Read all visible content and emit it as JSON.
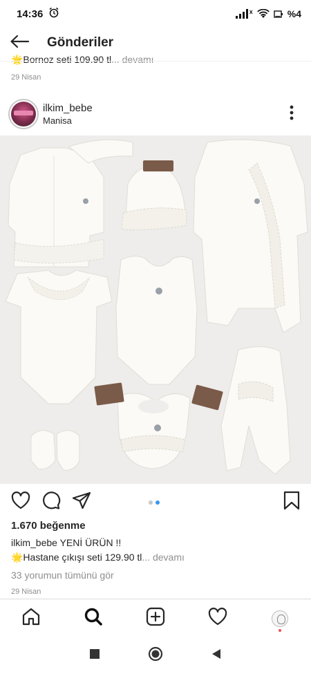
{
  "status_bar": {
    "time": "14:36",
    "battery": "%4"
  },
  "header": {
    "title": "Gönderiler"
  },
  "previous_post": {
    "caption_text": "🌟Bornoz seti 109.90 tl",
    "more_text": "... devamı",
    "date": "29 Nisan"
  },
  "post": {
    "username": "ilkim_bebe",
    "location": "Manisa",
    "likes": "1.670 beğenme",
    "caption_user": "ilkim_bebe",
    "caption_text": "YENİ ÜRÜN !!",
    "caption_line2": "🌟Hastane çıkışı seti 129.90 tl",
    "caption_more": "... devamı",
    "comments_link": "33 yorumun tümünü gör",
    "date": "29 Nisan",
    "carousel_count": 2,
    "carousel_active": 2
  },
  "icons": {
    "back": "arrow-left-icon",
    "more": "more-vertical-icon",
    "like": "heart-icon",
    "comment": "comment-icon",
    "share": "send-icon",
    "save": "bookmark-icon",
    "home": "home-icon",
    "search": "search-icon",
    "add": "add-post-icon",
    "activity": "heart-icon",
    "profile": "profile-avatar"
  },
  "colors": {
    "accent": "#3897f0",
    "text": "#262626",
    "muted": "#8e8e8e",
    "notification": "#ed4956"
  }
}
